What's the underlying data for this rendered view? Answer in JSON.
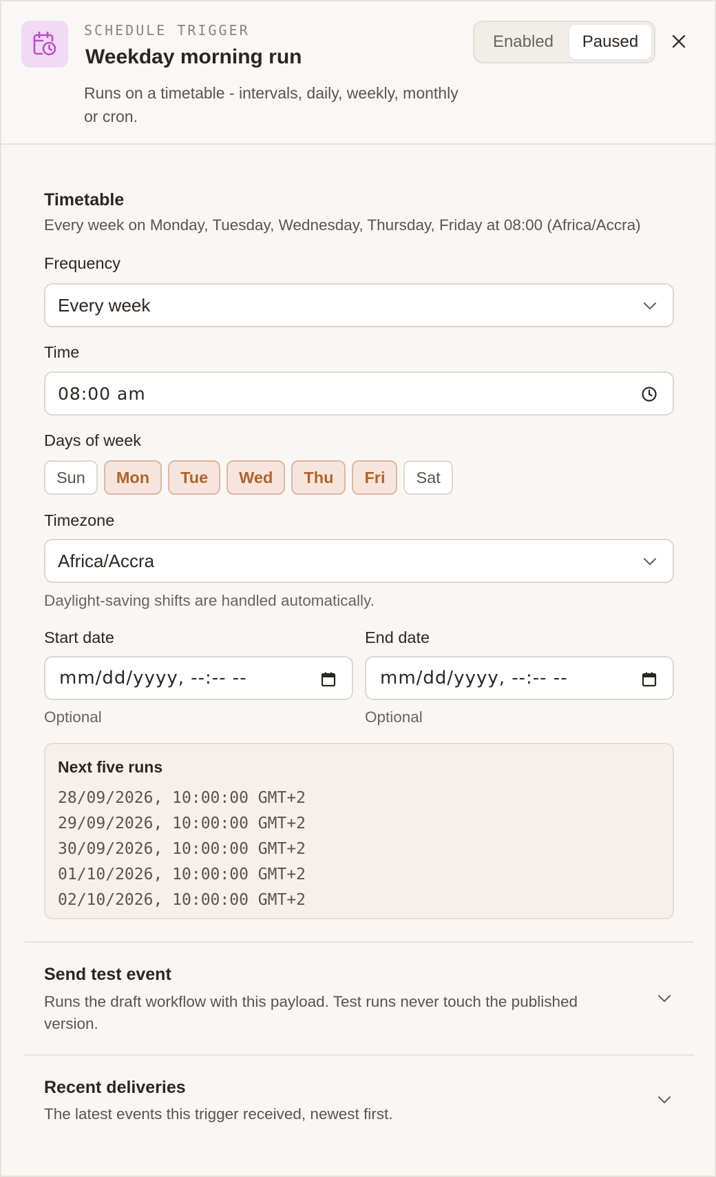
{
  "header": {
    "eyebrow": "SCHEDULE TRIGGER",
    "title": "Weekday morning run",
    "subtitle": "Runs on a timetable - intervals, daily, weekly, monthly or cron.",
    "icon": "calendar-clock-icon",
    "toggle": {
      "enabled_label": "Enabled",
      "paused_label": "Paused",
      "selected": "Paused"
    },
    "close_icon": "close-icon"
  },
  "timetable": {
    "title": "Timetable",
    "summary": "Every week on Monday, Tuesday, Wednesday, Thursday, Friday at 08:00 (Africa/Accra)"
  },
  "frequency": {
    "label": "Frequency",
    "value": "Every week"
  },
  "time": {
    "label": "Time",
    "value": "08:00 am"
  },
  "days": {
    "label": "Days of week",
    "items": [
      {
        "label": "Sun",
        "selected": false
      },
      {
        "label": "Mon",
        "selected": true
      },
      {
        "label": "Tue",
        "selected": true
      },
      {
        "label": "Wed",
        "selected": true
      },
      {
        "label": "Thu",
        "selected": true
      },
      {
        "label": "Fri",
        "selected": true
      },
      {
        "label": "Sat",
        "selected": false
      }
    ]
  },
  "timezone": {
    "label": "Timezone",
    "value": "Africa/Accra",
    "hint": "Daylight-saving shifts are handled automatically."
  },
  "start_date": {
    "label": "Start date",
    "placeholder": "mm/dd/yyyy, --:-- --",
    "hint": "Optional"
  },
  "end_date": {
    "label": "End date",
    "placeholder": "mm/dd/yyyy, --:-- --",
    "hint": "Optional"
  },
  "next_runs": {
    "title": "Next five runs",
    "items": [
      "28/09/2026, 10:00:00 GMT+2",
      "29/09/2026, 10:00:00 GMT+2",
      "30/09/2026, 10:00:00 GMT+2",
      "01/10/2026, 10:00:00 GMT+2",
      "02/10/2026, 10:00:00 GMT+2"
    ]
  },
  "test_event": {
    "title": "Send test event",
    "description": "Runs the draft workflow with this payload. Test runs never touch the published version."
  },
  "recent_deliveries": {
    "title": "Recent deliveries",
    "description": "The latest events this trigger received, newest first."
  },
  "colors": {
    "accent": "#b0622a",
    "accent_bg": "#f7e5dd",
    "icon_bg": "#f2d9f4",
    "icon_fg": "#b84fc8"
  }
}
